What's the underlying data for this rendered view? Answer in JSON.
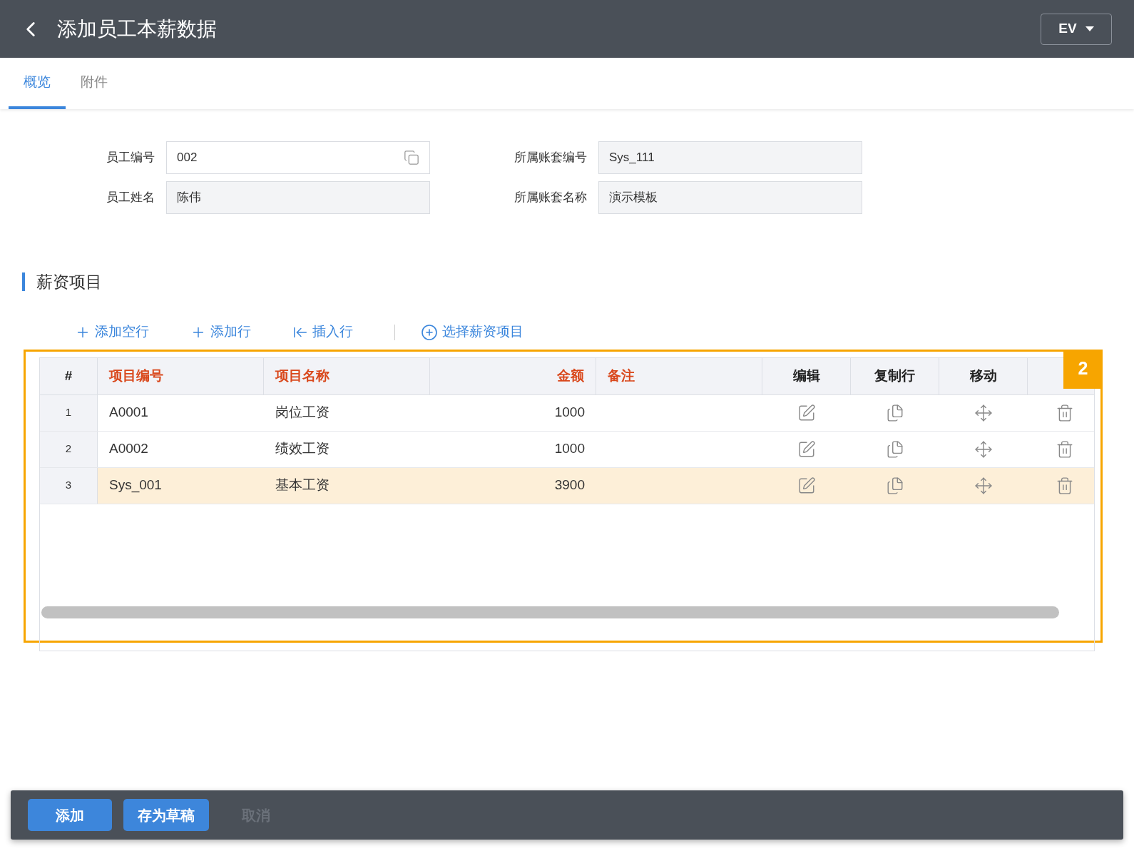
{
  "header": {
    "title": "添加员工本薪数据",
    "language": "EV"
  },
  "tabs": [
    {
      "label": "概览",
      "selected": true
    },
    {
      "label": "附件",
      "selected": false
    }
  ],
  "form": {
    "left": [
      {
        "label": "员工编号",
        "value": "002",
        "disabled": false
      },
      {
        "label": "员工姓名",
        "value": "陈伟",
        "disabled": true
      }
    ],
    "right": [
      {
        "label": "所属账套编号",
        "value": "Sys_111",
        "disabled": true
      },
      {
        "label": "所属账套名称",
        "value": "演示模板",
        "disabled": true
      }
    ]
  },
  "section_title": "薪资项目",
  "toolbar": [
    {
      "kind": "plus",
      "label": "添加空行"
    },
    {
      "kind": "plus",
      "label": "添加行"
    },
    {
      "kind": "insert",
      "label": "插入行"
    },
    {
      "kind": "select",
      "label": "选择薪资项目"
    }
  ],
  "table": {
    "columns": [
      "#",
      "项目编号",
      "项目名称",
      "金额",
      "备注",
      "编辑",
      "复制行",
      "移动"
    ],
    "rows": [
      {
        "index": "1",
        "code": "A0001",
        "name": "岗位工资",
        "amount": "1000",
        "selected": false
      },
      {
        "index": "2",
        "code": "A0002",
        "name": "绩效工资",
        "amount": "1000",
        "selected": false
      },
      {
        "index": "3",
        "code": "Sys_001",
        "name": "基本工资",
        "amount": "3900",
        "selected": true
      }
    ]
  },
  "callout": "2",
  "footer": [
    {
      "label": "添加",
      "disabled": false
    },
    {
      "label": "存为草稿",
      "disabled": false
    },
    {
      "label": "取消",
      "disabled": true
    }
  ]
}
